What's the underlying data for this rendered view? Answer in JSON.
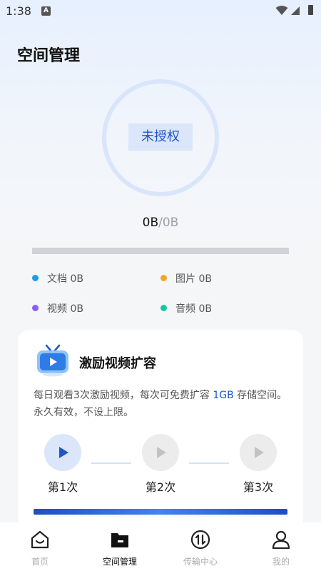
{
  "status_bar": {
    "time": "1:38",
    "indicator_letter": "A"
  },
  "header": {
    "title": "空间管理"
  },
  "storage": {
    "badge": "未授权",
    "used": "0B",
    "separator": "/",
    "total": "0B",
    "used_fraction": 0,
    "legend": [
      {
        "label": "文档 0B",
        "color": "#1a9cf0"
      },
      {
        "label": "图片 0B",
        "color": "#f5a623"
      },
      {
        "label": "视频 0B",
        "color": "#8b5cf6"
      },
      {
        "label": "音频 0B",
        "color": "#14c6a5"
      }
    ]
  },
  "reward_card": {
    "icon": "tv-video-icon",
    "title": "激励视频扩容",
    "desc_before": "每日观看3次激励视频，每次可免费扩容 ",
    "desc_highlight": "1GB",
    "desc_after": " 存储空间。永久有效，不设上限。",
    "steps": [
      {
        "label": "第1次",
        "active": true
      },
      {
        "label": "第2次",
        "active": false
      },
      {
        "label": "第3次",
        "active": false
      }
    ]
  },
  "tabbar": {
    "tabs": [
      {
        "label": "首页",
        "icon": "home-icon",
        "active": false
      },
      {
        "label": "空间管理",
        "icon": "folder-icon",
        "active": true
      },
      {
        "label": "传输中心",
        "icon": "transfer-icon",
        "active": false
      },
      {
        "label": "我的",
        "icon": "profile-icon",
        "active": false
      }
    ]
  },
  "colors": {
    "accent": "#1f56c9",
    "ring": "#d9e5fb",
    "progress_track": "#cfd3d8"
  }
}
